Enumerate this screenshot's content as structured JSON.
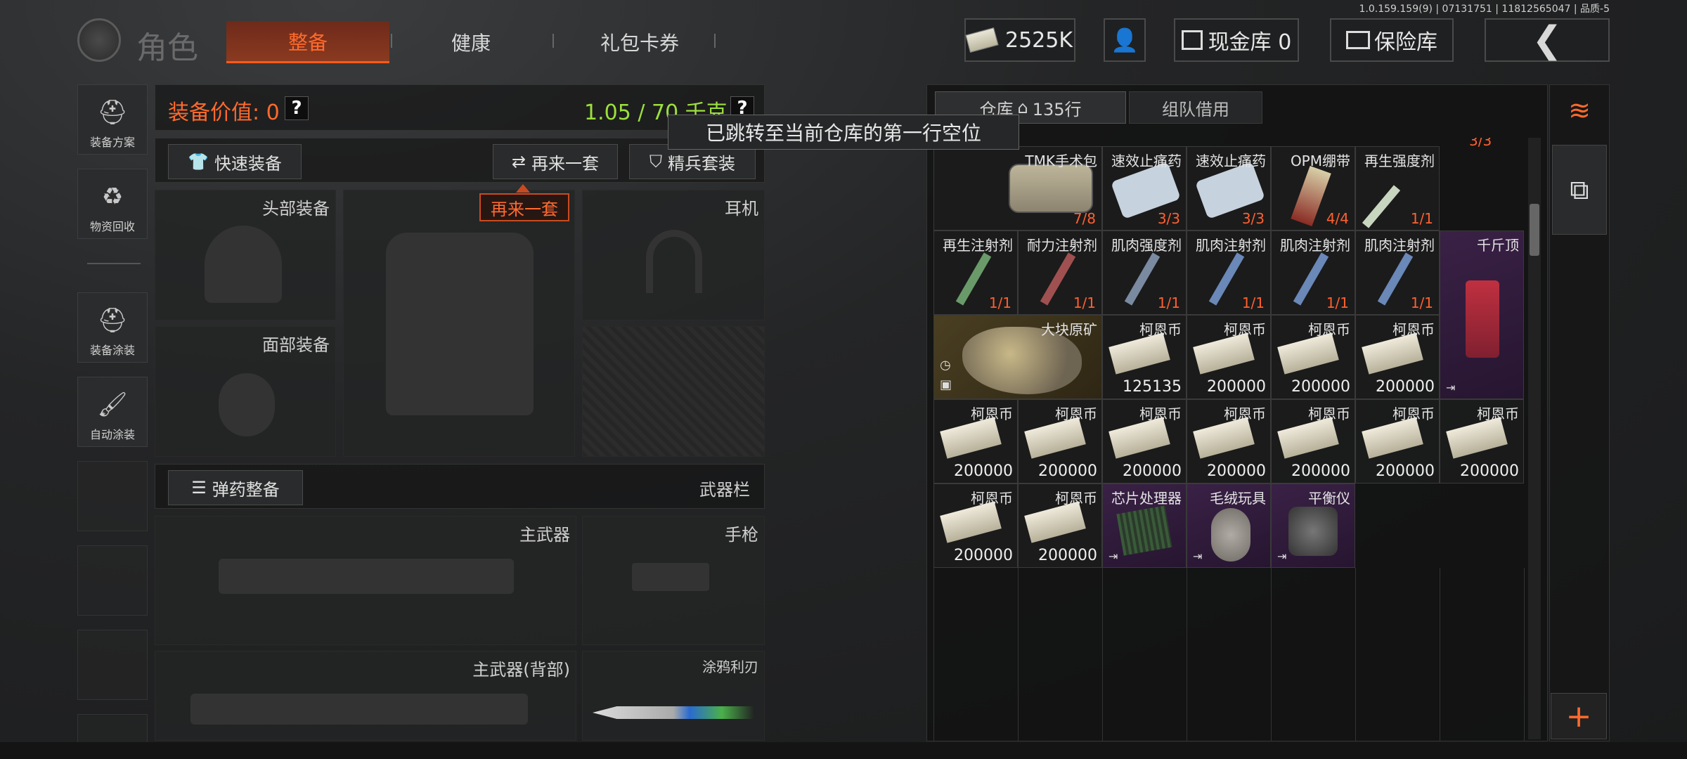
{
  "version": "1.0.159.159(9) | 07131751 | 11812565047 | 品质-5",
  "header": {
    "logo_title": "角色",
    "tabs": [
      "整备",
      "健康",
      "礼包卡券"
    ],
    "currency": "2525K",
    "cash_vault": "现金库 0",
    "safe_vault": "保险库",
    "back_icon": "chevron-left-icon"
  },
  "sidebar": {
    "items": [
      {
        "label": "装备方案",
        "icon": "loadout-icon"
      },
      {
        "label": "物资回收",
        "icon": "recycle-icon"
      },
      {
        "label": "装备涂装",
        "icon": "paint-helmet-icon"
      },
      {
        "label": "自动涂装",
        "icon": "auto-paint-icon"
      }
    ]
  },
  "equipment": {
    "value_label": "装备价值: 0",
    "weight": "1.05 / 70 千克",
    "quick_equip": "快速装备",
    "again": "再来一套",
    "elite": "精兵套装",
    "again_tip": "再来一套",
    "slots": {
      "head": "头部装备",
      "face": "面部装备",
      "headset": "耳机",
      "ammo": "弹药整备",
      "weapon_bar": "武器栏",
      "primary": "主武器",
      "pistol": "手枪",
      "primary_back": "主武器(背部)",
      "melee": "涂鸦利刃"
    }
  },
  "tooltip": "已跳转至当前仓库的第一行空位",
  "warehouse": {
    "tab_warehouse": "仓库",
    "rows": "135行",
    "tab_team": "组队借用",
    "top_count": "3/3",
    "items": [
      {
        "name": "TMK手术包",
        "count": "7/8"
      },
      {
        "name": "速效止痛药",
        "count": "3/3"
      },
      {
        "name": "速效止痛药",
        "count": "3/3"
      },
      {
        "name": "OPM绷带",
        "count": "4/4"
      },
      {
        "name": "再生强度剂",
        "count": "1/1"
      },
      {
        "name": "再生注射剂",
        "count": "1/1"
      },
      {
        "name": "耐力注射剂",
        "count": "1/1"
      },
      {
        "name": "肌肉强度剂",
        "count": "1/1"
      },
      {
        "name": "肌肉注射剂",
        "count": "1/1"
      },
      {
        "name": "肌肉注射剂",
        "count": "1/1"
      },
      {
        "name": "肌肉注射剂",
        "count": "1/1"
      },
      {
        "name": "千斤顶"
      },
      {
        "name": "大块原矿"
      },
      {
        "name": "柯恩币",
        "amount": "125135"
      },
      {
        "name": "柯恩币",
        "amount": "200000"
      },
      {
        "name": "柯恩币",
        "amount": "200000"
      },
      {
        "name": "柯恩币",
        "amount": "200000"
      },
      {
        "name": "柯恩币",
        "amount": "200000"
      },
      {
        "name": "柯恩币",
        "amount": "200000"
      },
      {
        "name": "柯恩币",
        "amount": "200000"
      },
      {
        "name": "柯恩币",
        "amount": "200000"
      },
      {
        "name": "柯恩币",
        "amount": "200000"
      },
      {
        "name": "柯恩币",
        "amount": "200000"
      },
      {
        "name": "柯恩币",
        "amount": "200000"
      },
      {
        "name": "柯恩币",
        "amount": "200000"
      },
      {
        "name": "柯恩币",
        "amount": "200000"
      },
      {
        "name": "芯片处理器"
      },
      {
        "name": "毛绒玩具"
      },
      {
        "name": "平衡仪"
      }
    ]
  },
  "right_bar": {
    "plus": "+"
  },
  "colors": {
    "accent": "#ff6a2c",
    "weight": "#9ce03c",
    "rare": "#3a2146",
    "gold": "#4a3f22"
  }
}
